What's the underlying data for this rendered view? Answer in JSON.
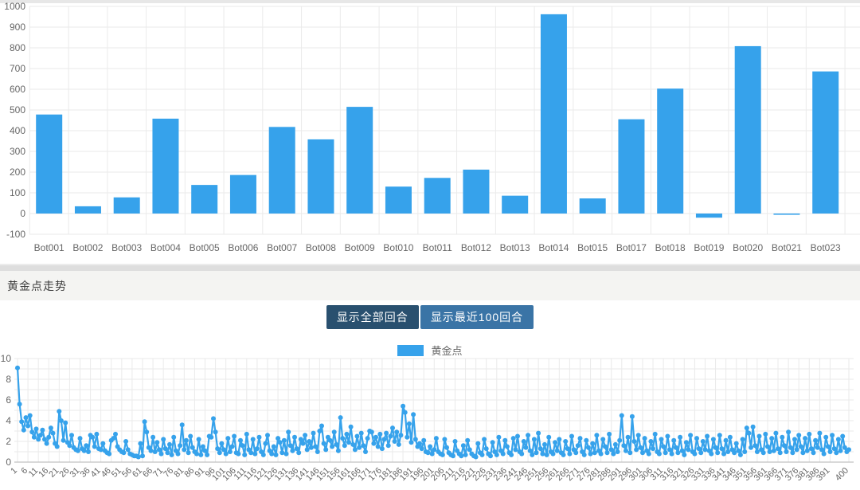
{
  "section": {
    "title": "黄金点走势"
  },
  "controls": {
    "show_all_label": "显示全部回合",
    "show_recent_label": "显示最近100回合"
  },
  "legend": {
    "label": "黄金点",
    "color": "#36a2eb"
  },
  "colors": {
    "series_blue": "#36a2eb",
    "grid": "#eaeaea",
    "axis_line": "#b3b3b3",
    "tick_text": "#666666",
    "button_active": "#29506f",
    "button_normal": "#3a74a6",
    "header_bg": "#f4f4f2",
    "divider": "#dedede"
  },
  "chart_data": [
    {
      "type": "bar",
      "title": "",
      "xlabel": "",
      "ylabel": "",
      "categories": [
        "Bot001",
        "Bot002",
        "Bot003",
        "Bot004",
        "Bot005",
        "Bot006",
        "Bot007",
        "Bot008",
        "Bot009",
        "Bot010",
        "Bot011",
        "Bot012",
        "Bot013",
        "Bot014",
        "Bot015",
        "Bot017",
        "Bot018",
        "Bot019",
        "Bot020",
        "Bot021",
        "Bot023"
      ],
      "values": [
        478,
        35,
        78,
        458,
        138,
        186,
        418,
        358,
        515,
        130,
        172,
        212,
        86,
        962,
        73,
        455,
        603,
        -20,
        808,
        -6,
        686
      ],
      "ylim": [
        -100,
        1000
      ],
      "ytick_step": 100,
      "grid": true,
      "legend_position": "none"
    },
    {
      "type": "line",
      "title": "",
      "series_name": "黄金点",
      "x_start": 1,
      "x_end": 400,
      "ylim": [
        0,
        10
      ],
      "ytick_labels": [
        0,
        2,
        4,
        6,
        8,
        10
      ],
      "grid_unit_y": 1,
      "grid": true,
      "legend_position": "top-center",
      "x_ticks": [
        1,
        6,
        11,
        16,
        21,
        26,
        31,
        36,
        41,
        46,
        51,
        56,
        61,
        66,
        71,
        76,
        81,
        86,
        91,
        96,
        101,
        106,
        111,
        116,
        121,
        126,
        131,
        136,
        141,
        146,
        151,
        156,
        161,
        166,
        171,
        176,
        181,
        186,
        191,
        196,
        201,
        206,
        211,
        216,
        221,
        226,
        231,
        236,
        241,
        246,
        251,
        256,
        261,
        266,
        271,
        276,
        281,
        286,
        291,
        296,
        301,
        306,
        311,
        316,
        321,
        326,
        331,
        336,
        341,
        346,
        351,
        356,
        361,
        366,
        371,
        376,
        381,
        386,
        391,
        400
      ],
      "values": [
        9.1,
        5.6,
        3.9,
        3.1,
        4.3,
        3.5,
        4.5,
        2.9,
        2.4,
        3.2,
        2.2,
        2.6,
        3.1,
        2.2,
        1.8,
        2.4,
        3.3,
        2.8,
        1.8,
        1.5,
        4.9,
        4.0,
        2.1,
        3.8,
        1.9,
        1.6,
        2.6,
        1.4,
        1.2,
        1.1,
        2.3,
        1.3,
        1.1,
        1.6,
        1.0,
        2.6,
        2.4,
        1.5,
        2.7,
        1.3,
        1.2,
        1.8,
        1.1,
        0.9,
        0.8,
        2.1,
        2.3,
        2.7,
        1.5,
        1.2,
        1.0,
        0.9,
        2.0,
        1.2,
        0.8,
        0.7,
        0.6,
        0.6,
        0.5,
        1.8,
        0.6,
        3.9,
        2.9,
        1.4,
        1.1,
        2.4,
        1.0,
        1.9,
        1.2,
        0.8,
        2.2,
        1.3,
        0.9,
        1.7,
        0.7,
        2.4,
        1.1,
        0.8,
        1.6,
        3.6,
        1.2,
        2.1,
        0.9,
        2.5,
        1.4,
        1.0,
        0.8,
        2.2,
        0.7,
        1.5,
        1.1,
        0.7,
        2.5,
        2.4,
        4.2,
        2.9,
        1.3,
        0.9,
        1.8,
        1.2,
        0.8,
        2.3,
        1.0,
        1.5,
        2.5,
        0.9,
        0.8,
        2.1,
        1.6,
        0.7,
        2.7,
        1.2,
        0.9,
        2.2,
        0.8,
        1.3,
        2.4,
        1.0,
        0.7,
        1.8,
        2.6,
        1.1,
        0.8,
        1.5,
        0.7,
        2.3,
        1.9,
        0.9,
        2.1,
        0.8,
        2.9,
        1.6,
        1.1,
        2.4,
        1.3,
        0.9,
        2.2,
        1.8,
        2.6,
        1.2,
        2.0,
        1.4,
        2.8,
        1.5,
        1.0,
        3.0,
        3.5,
        1.8,
        1.2,
        2.4,
        2.1,
        1.5,
        2.9,
        1.7,
        1.1,
        4.3,
        2.3,
        1.6,
        2.7,
        1.9,
        3.4,
        1.7,
        1.2,
        2.5,
        1.4,
        2.8,
        1.6,
        1.0,
        2.3,
        3.0,
        2.9,
        1.8,
        2.4,
        1.5,
        2.7,
        1.3,
        2.2,
        2.8,
        1.6,
        2.5,
        3.3,
        2.0,
        2.9,
        1.7,
        2.6,
        5.4,
        4.8,
        2.4,
        3.7,
        1.9,
        4.6,
        2.2,
        1.5,
        1.8,
        1.3,
        2.1,
        1.0,
        0.9,
        1.5,
        0.8,
        1.2,
        2.3,
        1.0,
        0.8,
        0.7,
        2.2,
        1.4,
        0.9,
        0.7,
        0.6,
        2.0,
        1.1,
        0.8,
        0.6,
        1.6,
        0.7,
        2.1,
        1.2,
        0.8,
        0.6,
        0.5,
        1.8,
        0.9,
        0.7,
        2.2,
        1.3,
        0.8,
        0.6,
        1.9,
        1.0,
        0.7,
        2.4,
        1.1,
        0.8,
        2.1,
        1.5,
        0.9,
        0.7,
        2.3,
        1.2,
        2.5,
        1.0,
        0.8,
        2.0,
        1.4,
        2.6,
        1.1,
        0.7,
        2.2,
        0.9,
        2.8,
        1.3,
        0.8,
        1.7,
        0.7,
        2.4,
        1.0,
        0.8,
        1.9,
        1.1,
        2.2,
        0.9,
        0.7,
        2.0,
        1.3,
        0.8,
        2.5,
        1.2,
        0.9,
        1.6,
        2.3,
        1.0,
        0.7,
        2.1,
        1.4,
        0.8,
        1.8,
        0.9,
        2.6,
        1.1,
        0.8,
        2.2,
        1.5,
        0.9,
        2.7,
        1.2,
        0.8,
        1.7,
        1.0,
        2.1,
        4.5,
        1.6,
        1.1,
        2.4,
        0.9,
        4.4,
        2.0,
        1.2,
        2.6,
        1.4,
        0.9,
        2.3,
        1.1,
        0.8,
        2.0,
        1.3,
        2.7,
        1.0,
        0.8,
        2.2,
        1.5,
        0.9,
        2.5,
        1.2,
        0.8,
        2.1,
        1.4,
        0.9,
        2.4,
        1.1,
        0.7,
        1.9,
        1.2,
        2.6,
        1.0,
        0.8,
        2.3,
        1.3,
        0.9,
        2.0,
        1.2,
        2.5,
        1.1,
        0.8,
        2.2,
        1.4,
        0.9,
        2.6,
        1.3,
        0.8,
        2.1,
        1.0,
        2.4,
        1.2,
        0.9,
        1.8,
        1.1,
        0.7,
        2.2,
        1.0,
        3.3,
        2.8,
        1.4,
        3.4,
        1.6,
        1.0,
        2.5,
        1.2,
        0.9,
        2.7,
        1.5,
        1.0,
        2.3,
        1.1,
        2.8,
        1.3,
        0.9,
        2.4,
        1.6,
        1.0,
        2.9,
        1.4,
        0.9,
        2.2,
        1.2,
        2.6,
        1.5,
        0.9,
        2.3,
        1.1,
        2.7,
        1.3,
        0.9,
        2.1,
        1.4,
        2.8,
        1.2,
        0.8,
        2.4,
        1.5,
        1.0,
        2.6,
        1.3,
        0.9,
        2.2,
        1.1,
        2.5,
        1.4,
        1.0,
        1.2
      ]
    }
  ]
}
